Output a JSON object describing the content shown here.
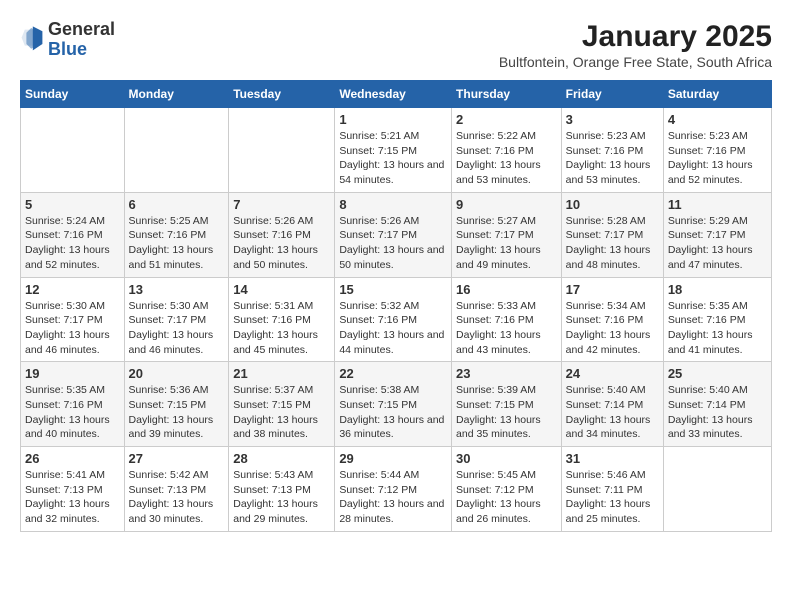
{
  "logo": {
    "general": "General",
    "blue": "Blue"
  },
  "title": "January 2025",
  "subtitle": "Bultfontein, Orange Free State, South Africa",
  "weekdays": [
    "Sunday",
    "Monday",
    "Tuesday",
    "Wednesday",
    "Thursday",
    "Friday",
    "Saturday"
  ],
  "weeks": [
    [
      {
        "day": "",
        "sunrise": "",
        "sunset": "",
        "daylight": ""
      },
      {
        "day": "",
        "sunrise": "",
        "sunset": "",
        "daylight": ""
      },
      {
        "day": "",
        "sunrise": "",
        "sunset": "",
        "daylight": ""
      },
      {
        "day": "1",
        "sunrise": "Sunrise: 5:21 AM",
        "sunset": "Sunset: 7:15 PM",
        "daylight": "Daylight: 13 hours and 54 minutes."
      },
      {
        "day": "2",
        "sunrise": "Sunrise: 5:22 AM",
        "sunset": "Sunset: 7:16 PM",
        "daylight": "Daylight: 13 hours and 53 minutes."
      },
      {
        "day": "3",
        "sunrise": "Sunrise: 5:23 AM",
        "sunset": "Sunset: 7:16 PM",
        "daylight": "Daylight: 13 hours and 53 minutes."
      },
      {
        "day": "4",
        "sunrise": "Sunrise: 5:23 AM",
        "sunset": "Sunset: 7:16 PM",
        "daylight": "Daylight: 13 hours and 52 minutes."
      }
    ],
    [
      {
        "day": "5",
        "sunrise": "Sunrise: 5:24 AM",
        "sunset": "Sunset: 7:16 PM",
        "daylight": "Daylight: 13 hours and 52 minutes."
      },
      {
        "day": "6",
        "sunrise": "Sunrise: 5:25 AM",
        "sunset": "Sunset: 7:16 PM",
        "daylight": "Daylight: 13 hours and 51 minutes."
      },
      {
        "day": "7",
        "sunrise": "Sunrise: 5:26 AM",
        "sunset": "Sunset: 7:16 PM",
        "daylight": "Daylight: 13 hours and 50 minutes."
      },
      {
        "day": "8",
        "sunrise": "Sunrise: 5:26 AM",
        "sunset": "Sunset: 7:17 PM",
        "daylight": "Daylight: 13 hours and 50 minutes."
      },
      {
        "day": "9",
        "sunrise": "Sunrise: 5:27 AM",
        "sunset": "Sunset: 7:17 PM",
        "daylight": "Daylight: 13 hours and 49 minutes."
      },
      {
        "day": "10",
        "sunrise": "Sunrise: 5:28 AM",
        "sunset": "Sunset: 7:17 PM",
        "daylight": "Daylight: 13 hours and 48 minutes."
      },
      {
        "day": "11",
        "sunrise": "Sunrise: 5:29 AM",
        "sunset": "Sunset: 7:17 PM",
        "daylight": "Daylight: 13 hours and 47 minutes."
      }
    ],
    [
      {
        "day": "12",
        "sunrise": "Sunrise: 5:30 AM",
        "sunset": "Sunset: 7:17 PM",
        "daylight": "Daylight: 13 hours and 46 minutes."
      },
      {
        "day": "13",
        "sunrise": "Sunrise: 5:30 AM",
        "sunset": "Sunset: 7:17 PM",
        "daylight": "Daylight: 13 hours and 46 minutes."
      },
      {
        "day": "14",
        "sunrise": "Sunrise: 5:31 AM",
        "sunset": "Sunset: 7:16 PM",
        "daylight": "Daylight: 13 hours and 45 minutes."
      },
      {
        "day": "15",
        "sunrise": "Sunrise: 5:32 AM",
        "sunset": "Sunset: 7:16 PM",
        "daylight": "Daylight: 13 hours and 44 minutes."
      },
      {
        "day": "16",
        "sunrise": "Sunrise: 5:33 AM",
        "sunset": "Sunset: 7:16 PM",
        "daylight": "Daylight: 13 hours and 43 minutes."
      },
      {
        "day": "17",
        "sunrise": "Sunrise: 5:34 AM",
        "sunset": "Sunset: 7:16 PM",
        "daylight": "Daylight: 13 hours and 42 minutes."
      },
      {
        "day": "18",
        "sunrise": "Sunrise: 5:35 AM",
        "sunset": "Sunset: 7:16 PM",
        "daylight": "Daylight: 13 hours and 41 minutes."
      }
    ],
    [
      {
        "day": "19",
        "sunrise": "Sunrise: 5:35 AM",
        "sunset": "Sunset: 7:16 PM",
        "daylight": "Daylight: 13 hours and 40 minutes."
      },
      {
        "day": "20",
        "sunrise": "Sunrise: 5:36 AM",
        "sunset": "Sunset: 7:15 PM",
        "daylight": "Daylight: 13 hours and 39 minutes."
      },
      {
        "day": "21",
        "sunrise": "Sunrise: 5:37 AM",
        "sunset": "Sunset: 7:15 PM",
        "daylight": "Daylight: 13 hours and 38 minutes."
      },
      {
        "day": "22",
        "sunrise": "Sunrise: 5:38 AM",
        "sunset": "Sunset: 7:15 PM",
        "daylight": "Daylight: 13 hours and 36 minutes."
      },
      {
        "day": "23",
        "sunrise": "Sunrise: 5:39 AM",
        "sunset": "Sunset: 7:15 PM",
        "daylight": "Daylight: 13 hours and 35 minutes."
      },
      {
        "day": "24",
        "sunrise": "Sunrise: 5:40 AM",
        "sunset": "Sunset: 7:14 PM",
        "daylight": "Daylight: 13 hours and 34 minutes."
      },
      {
        "day": "25",
        "sunrise": "Sunrise: 5:40 AM",
        "sunset": "Sunset: 7:14 PM",
        "daylight": "Daylight: 13 hours and 33 minutes."
      }
    ],
    [
      {
        "day": "26",
        "sunrise": "Sunrise: 5:41 AM",
        "sunset": "Sunset: 7:13 PM",
        "daylight": "Daylight: 13 hours and 32 minutes."
      },
      {
        "day": "27",
        "sunrise": "Sunrise: 5:42 AM",
        "sunset": "Sunset: 7:13 PM",
        "daylight": "Daylight: 13 hours and 30 minutes."
      },
      {
        "day": "28",
        "sunrise": "Sunrise: 5:43 AM",
        "sunset": "Sunset: 7:13 PM",
        "daylight": "Daylight: 13 hours and 29 minutes."
      },
      {
        "day": "29",
        "sunrise": "Sunrise: 5:44 AM",
        "sunset": "Sunset: 7:12 PM",
        "daylight": "Daylight: 13 hours and 28 minutes."
      },
      {
        "day": "30",
        "sunrise": "Sunrise: 5:45 AM",
        "sunset": "Sunset: 7:12 PM",
        "daylight": "Daylight: 13 hours and 26 minutes."
      },
      {
        "day": "31",
        "sunrise": "Sunrise: 5:46 AM",
        "sunset": "Sunset: 7:11 PM",
        "daylight": "Daylight: 13 hours and 25 minutes."
      },
      {
        "day": "",
        "sunrise": "",
        "sunset": "",
        "daylight": ""
      }
    ]
  ]
}
